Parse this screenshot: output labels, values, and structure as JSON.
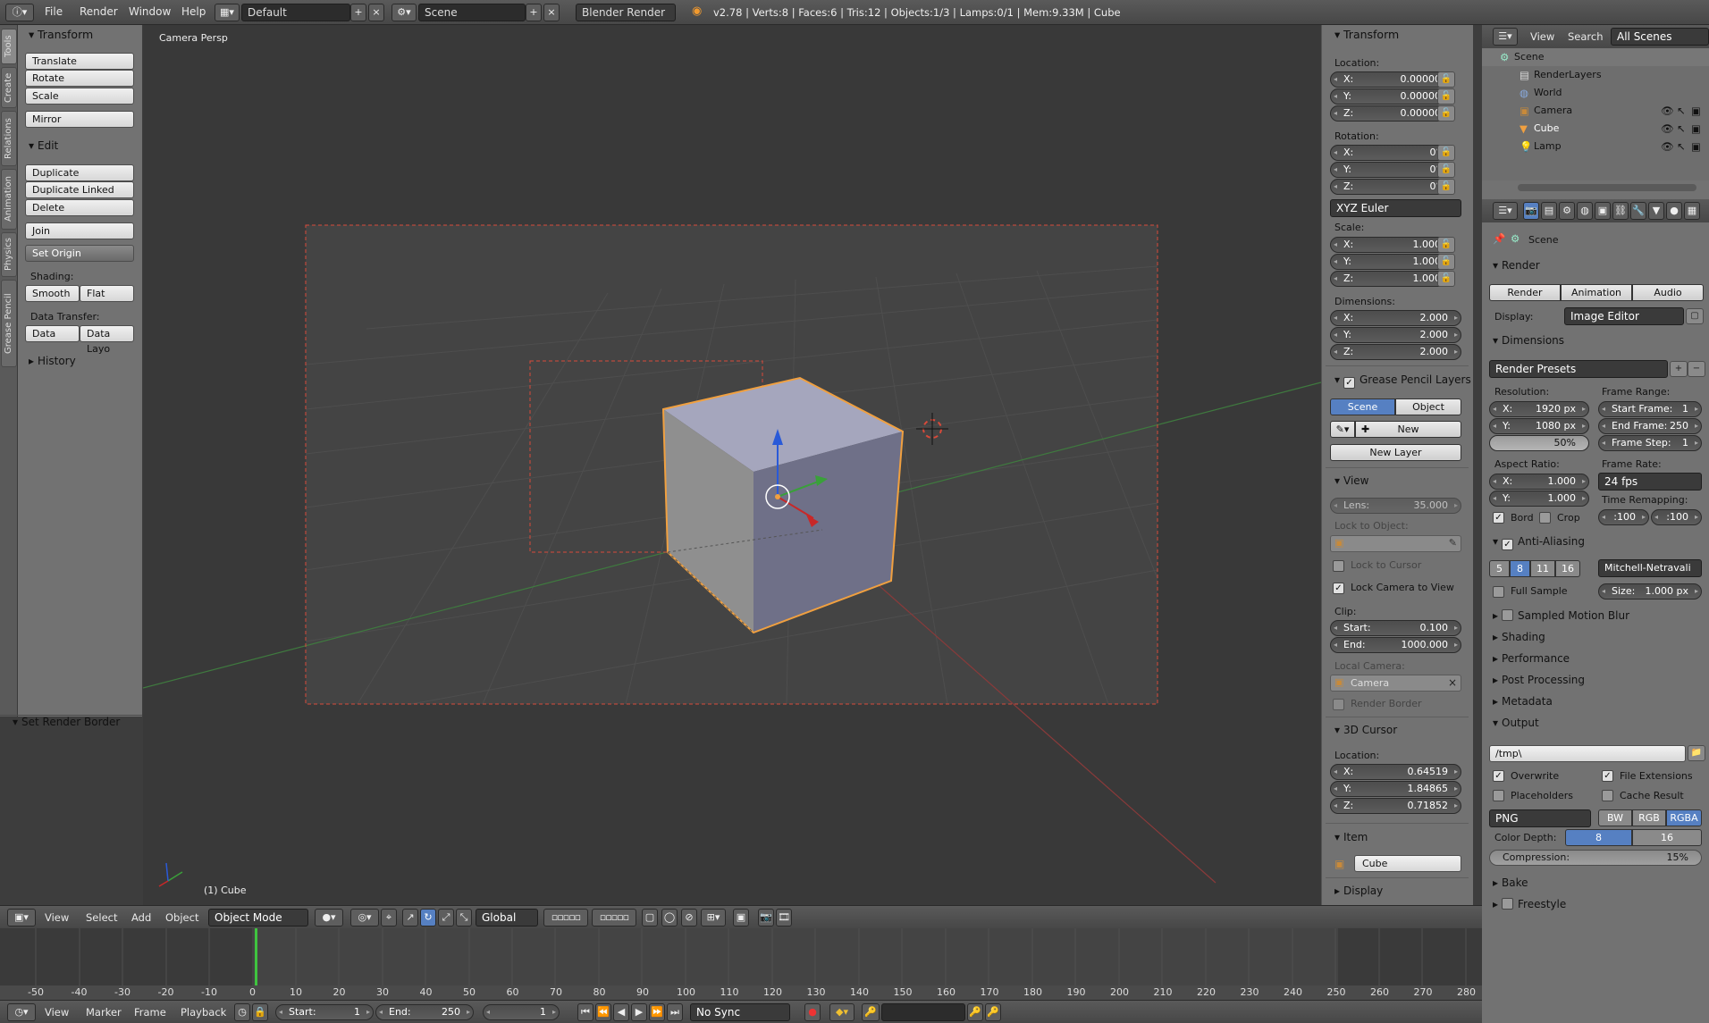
{
  "topbar": {
    "menu": [
      "File",
      "Render",
      "Window",
      "Help"
    ],
    "layout": "Default",
    "scene": "Scene",
    "engine": "Blender Render",
    "stats": "v2.78 | Verts:8 | Faces:6 | Tris:12 | Objects:1/3 | Lamps:0/1 | Mem:9.33M | Cube"
  },
  "tabs": [
    "Tools",
    "Create",
    "Relations",
    "Animation",
    "Physics",
    "Grease Pencil"
  ],
  "toolshelf": {
    "transform_title": "Transform",
    "translate": "Translate",
    "rotate": "Rotate",
    "scale": "Scale",
    "mirror": "Mirror",
    "edit_title": "Edit",
    "duplicate": "Duplicate",
    "duplicate_linked": "Duplicate Linked",
    "delete": "Delete",
    "join": "Join",
    "set_origin": "Set Origin",
    "shading_label": "Shading:",
    "smooth": "Smooth",
    "flat": "Flat",
    "data_transfer_label": "Data Transfer:",
    "data": "Data",
    "data_layo": "Data Layo",
    "history": "History",
    "operator": "Set Render Border"
  },
  "viewport": {
    "label": "Camera Persp",
    "object": "(1) Cube"
  },
  "npanel": {
    "transform": "Transform",
    "location": "Location:",
    "loc": [
      {
        "k": "X:",
        "v": "0.00000"
      },
      {
        "k": "Y:",
        "v": "0.00000"
      },
      {
        "k": "Z:",
        "v": "0.00000"
      }
    ],
    "rotation": "Rotation:",
    "rot": [
      {
        "k": "X:",
        "v": "0°"
      },
      {
        "k": "Y:",
        "v": "0°"
      },
      {
        "k": "Z:",
        "v": "0°"
      }
    ],
    "euler": "XYZ Euler",
    "scale": "Scale:",
    "scl": [
      {
        "k": "X:",
        "v": "1.000"
      },
      {
        "k": "Y:",
        "v": "1.000"
      },
      {
        "k": "Z:",
        "v": "1.000"
      }
    ],
    "dimensions": "Dimensions:",
    "dim": [
      {
        "k": "X:",
        "v": "2.000"
      },
      {
        "k": "Y:",
        "v": "2.000"
      },
      {
        "k": "Z:",
        "v": "2.000"
      }
    ],
    "gp_layers": "Grease Pencil Layers",
    "gp_scene": "Scene",
    "gp_object": "Object",
    "gp_new": "New",
    "gp_new_layer": "New Layer",
    "view": "View",
    "lens_k": "Lens:",
    "lens_v": "35.000",
    "lock_object": "Lock to Object:",
    "lock_cursor": "Lock to Cursor",
    "lock_camera": "Lock Camera to View",
    "clip": "Clip:",
    "clip_start_k": "Start:",
    "clip_start_v": "0.100",
    "clip_end_k": "End:",
    "clip_end_v": "1000.000",
    "local_camera": "Local Camera:",
    "camera": "Camera",
    "render_border": "Render Border",
    "cursor": "3D Cursor",
    "cursor_location": "Location:",
    "cur": [
      {
        "k": "X:",
        "v": "0.64519"
      },
      {
        "k": "Y:",
        "v": "1.84865"
      },
      {
        "k": "Z:",
        "v": "0.71852"
      }
    ],
    "item": "Item",
    "item_name": "Cube",
    "display": "Display"
  },
  "outliner": {
    "menu": [
      "View",
      "Search"
    ],
    "filter": "All Scenes",
    "items": [
      "Scene",
      "RenderLayers",
      "World",
      "Camera",
      "Cube",
      "Lamp"
    ]
  },
  "props": {
    "scene": "Scene",
    "render_title": "Render",
    "render_btn": "Render",
    "animation_btn": "Animation",
    "audio_btn": "Audio",
    "display_label": "Display:",
    "display_value": "Image Editor",
    "dimensions": "Dimensions",
    "render_presets": "Render Presets",
    "resolution": "Resolution:",
    "res_x_k": "X:",
    "res_x_v": "1920 px",
    "res_y_k": "Y:",
    "res_y_v": "1080 px",
    "res_pct": "50%",
    "frame_range": "Frame Range:",
    "start_k": "Start Frame:",
    "start_v": "1",
    "end_k": "End Frame:",
    "end_v": "250",
    "step_k": "Frame Step:",
    "step_v": "1",
    "aspect": "Aspect Ratio:",
    "asp_x_k": "X:",
    "asp_x_v": "1.000",
    "asp_y_k": "Y:",
    "asp_y_v": "1.000",
    "frame_rate": "Frame Rate:",
    "fps": "24 fps",
    "time_remap": "Time Remapping:",
    "old": ":100",
    "new": ":100",
    "bord": "Bord",
    "crop": "Crop",
    "anti_aliasing": "Anti-Aliasing",
    "aa": [
      "5",
      "8",
      "11",
      "16"
    ],
    "filter": "Mitchell-Netravali",
    "full_sample": "Full Sample",
    "size_k": "Size:",
    "size_v": "1.000 px",
    "motion_blur": "Sampled Motion Blur",
    "shading": "Shading",
    "performance": "Performance",
    "post_processing": "Post Processing",
    "metadata": "Metadata",
    "output": "Output",
    "path": "/tmp\\",
    "overwrite": "Overwrite",
    "file_ext": "File Extensions",
    "placeholders": "Placeholders",
    "cache": "Cache Result",
    "format": "PNG",
    "bw": "BW",
    "rgb": "RGB",
    "rgba": "RGBA",
    "color_depth": "Color Depth:",
    "d8": "8",
    "d16": "16",
    "compression": "Compression:",
    "comp_v": "15%",
    "bake": "Bake",
    "freestyle": "Freestyle"
  },
  "header3d": {
    "menu": [
      "View",
      "Select",
      "Add",
      "Object"
    ],
    "mode": "Object Mode",
    "orientation": "Global"
  },
  "timeline": {
    "ticks": [
      "-50",
      "-40",
      "-30",
      "-20",
      "-10",
      "0",
      "10",
      "20",
      "30",
      "40",
      "50",
      "60",
      "70",
      "80",
      "90",
      "100",
      "110",
      "120",
      "130",
      "140",
      "150",
      "160",
      "170",
      "180",
      "190",
      "200",
      "210",
      "220",
      "230",
      "240",
      "250",
      "260",
      "270",
      "280"
    ],
    "menu": [
      "View",
      "Marker",
      "Frame",
      "Playback"
    ],
    "start_k": "Start:",
    "start_v": "1",
    "end_k": "End:",
    "end_v": "250",
    "current": "1",
    "sync": "No Sync"
  }
}
